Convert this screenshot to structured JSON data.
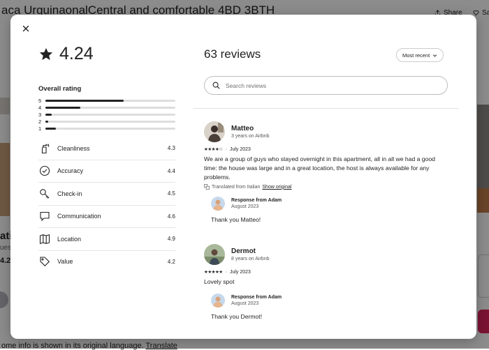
{
  "background": {
    "listing_title": "aca UrguinaonalCentral and comfortable 4BD 3BTH",
    "share_label": "Share",
    "save_label": "Sa",
    "side_text_1": "atin",
    "side_text_2": "ues",
    "side_text_3": "4.2",
    "footer_text": "ome info is shown in its original language.",
    "footer_link": "Translate"
  },
  "modal": {
    "close_icon": "close-icon",
    "overall": {
      "rating_icon": "star-icon",
      "rating": "4.24",
      "label": "Overall rating",
      "distribution": [
        {
          "stars": "5",
          "fraction": 0.6
        },
        {
          "stars": "4",
          "fraction": 0.27
        },
        {
          "stars": "3",
          "fraction": 0.05
        },
        {
          "stars": "2",
          "fraction": 0.02
        },
        {
          "stars": "1",
          "fraction": 0.08
        }
      ]
    },
    "categories": [
      {
        "label": "Cleanliness",
        "score": "4.3",
        "icon": "spray-bottle-icon"
      },
      {
        "label": "Accuracy",
        "score": "4.4",
        "icon": "check-circle-icon"
      },
      {
        "label": "Check-in",
        "score": "4.5",
        "icon": "key-icon"
      },
      {
        "label": "Communication",
        "score": "4.6",
        "icon": "chat-bubble-icon"
      },
      {
        "label": "Location",
        "score": "4.9",
        "icon": "map-icon"
      },
      {
        "label": "Value",
        "score": "4.2",
        "icon": "tag-icon"
      }
    ],
    "reviews_header": {
      "count": "63 reviews",
      "sort_label": "Most recent",
      "search_placeholder": "Search reviews"
    },
    "reviews": [
      {
        "name": "Matteo",
        "tenure": "3 years on Airbnb",
        "rating": 4,
        "date": "July 2023",
        "text": "We are a group of guys who stayed overnight in this apartment, all in all we had a good time: the house was large and in a great location, the host is always available for any problems.",
        "translated_note": "Translated from Italian",
        "translated_link": "Show original",
        "response": {
          "title": "Response from Adam",
          "date": "August 2023",
          "text": "Thank you Matteo!"
        }
      },
      {
        "name": "Dermot",
        "tenure": "8 years on Airbnb",
        "rating": 5,
        "date": "July 2023",
        "text": "Lovely spot",
        "response": {
          "title": "Response from Adam",
          "date": "August 2023",
          "text": "Thank you Dermot!"
        }
      }
    ]
  }
}
